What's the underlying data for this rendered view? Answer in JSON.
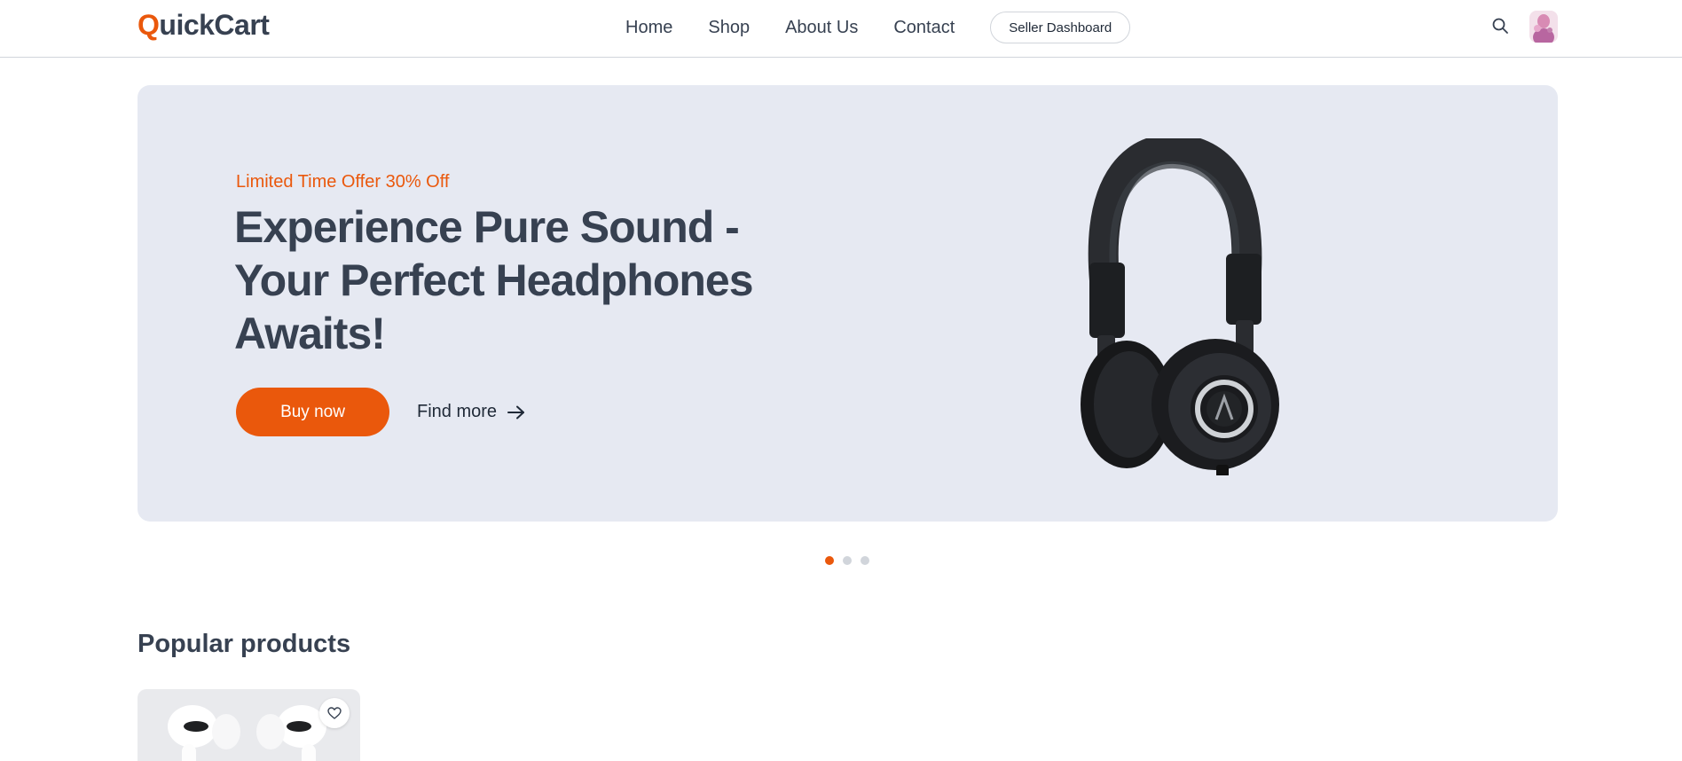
{
  "header": {
    "logo_first": "Q",
    "logo_rest": "uickCart",
    "nav": [
      "Home",
      "Shop",
      "About Us",
      "Contact"
    ],
    "seller_label": "Seller Dashboard",
    "icons": {
      "search": "search-icon",
      "avatar": "avatar"
    }
  },
  "hero": {
    "offer": "Limited Time Offer 30% Off",
    "title": "Experience Pure Sound - Your Perfect Headphones Awaits!",
    "buy_label": "Buy now",
    "find_label": "Find more",
    "find_icon": "arrow-right-icon",
    "image": "headphones-image",
    "slides": {
      "count": 3,
      "active": 1
    }
  },
  "products": {
    "section_title": "Popular products",
    "items": [
      {
        "image": "earbuds-image",
        "wishlist_icon": "heart-icon"
      }
    ]
  },
  "colors": {
    "accent": "#ea580c",
    "text": "#374151",
    "hero_bg": "#e6e9f2",
    "card_bg": "#e9eaed"
  }
}
